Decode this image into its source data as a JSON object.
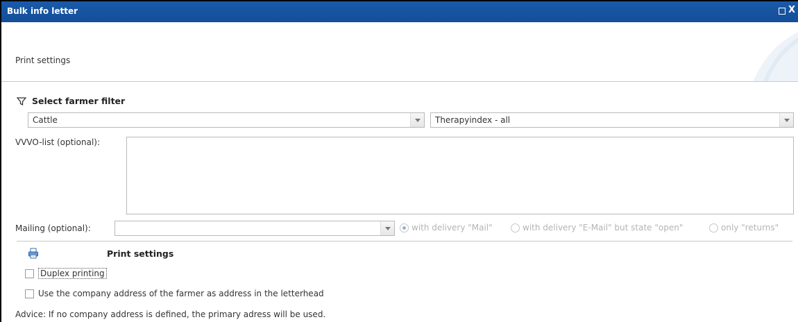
{
  "window": {
    "title": "Bulk info letter",
    "close_glyph": "X"
  },
  "header": {
    "section_title": "Print settings"
  },
  "filter": {
    "heading": "Select farmer filter",
    "animal_select_value": "Cattle",
    "index_select_value": "Therapyindex - all"
  },
  "vvvo": {
    "label": "VVVO-list (optional):",
    "value": ""
  },
  "mailing": {
    "label": "Mailing (optional):",
    "select_value": "",
    "options": [
      {
        "label": "with delivery \"Mail\"",
        "checked": true
      },
      {
        "label": "with delivery \"E-Mail\" but state \"open\"",
        "checked": false
      },
      {
        "label": "only \"returns\"",
        "checked": false
      }
    ]
  },
  "print": {
    "heading": "Print settings",
    "duplex_label": "Duplex printing",
    "company_address_label": "Use the company address of the farmer as address in the letterhead",
    "advice": "Advice: If no company address is defined, the primary adress will be used."
  },
  "colors": {
    "titlebar": "#134e99",
    "disabled_text": "#b4b4b4"
  }
}
